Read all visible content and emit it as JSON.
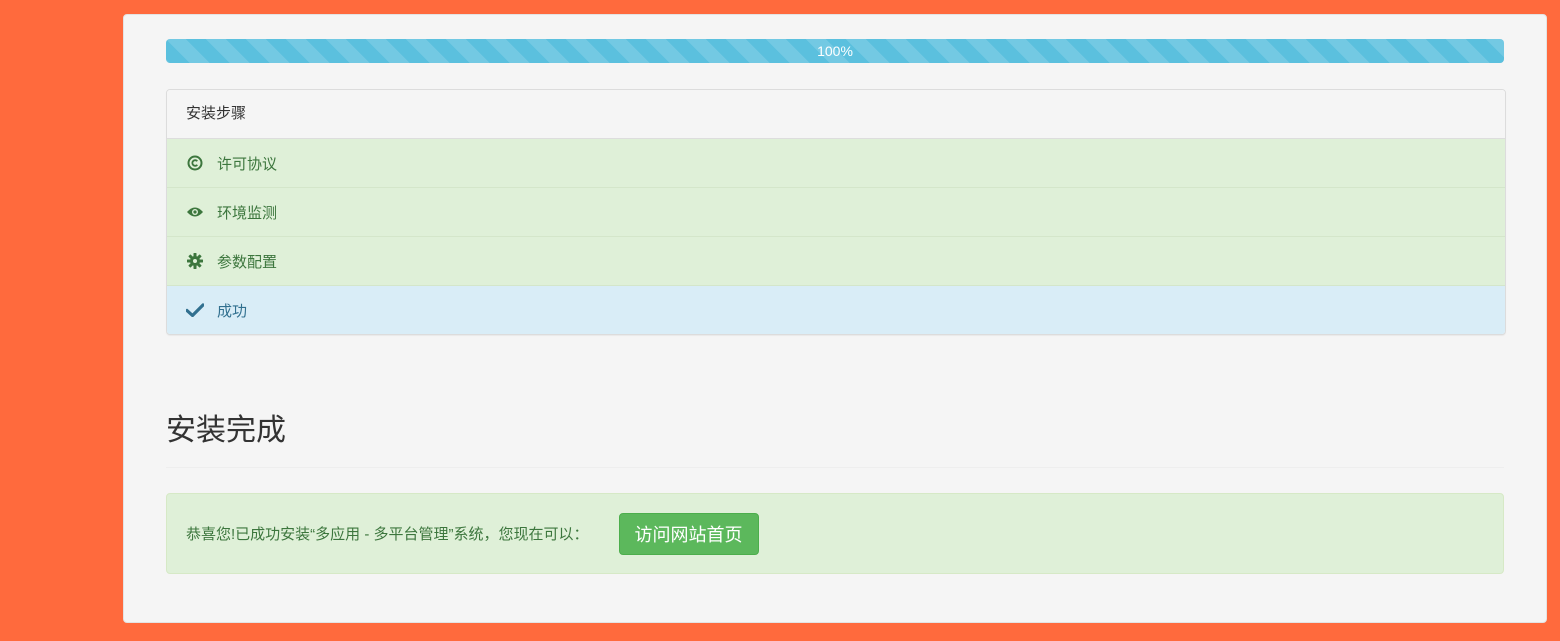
{
  "progress": {
    "value": 1.0,
    "label": "100%",
    "color": "#5bc0de"
  },
  "steps": {
    "heading": "安装步骤",
    "items": [
      {
        "label": "许可协议",
        "icon": "copyright-icon",
        "state": "done"
      },
      {
        "label": "环境监测",
        "icon": "eye-icon",
        "state": "done"
      },
      {
        "label": "参数配置",
        "icon": "cog-icon",
        "state": "done"
      },
      {
        "label": "成功",
        "icon": "check-icon",
        "state": "current"
      }
    ]
  },
  "main": {
    "title": "安装完成",
    "message": "恭喜您!已成功安装“多应用 - 多平台管理”系统，您现在可以：",
    "visit_button": "访问网站首页"
  },
  "colors": {
    "background": "#ff6a3d",
    "success": "#5cb85c",
    "info": "#5bc0de"
  }
}
